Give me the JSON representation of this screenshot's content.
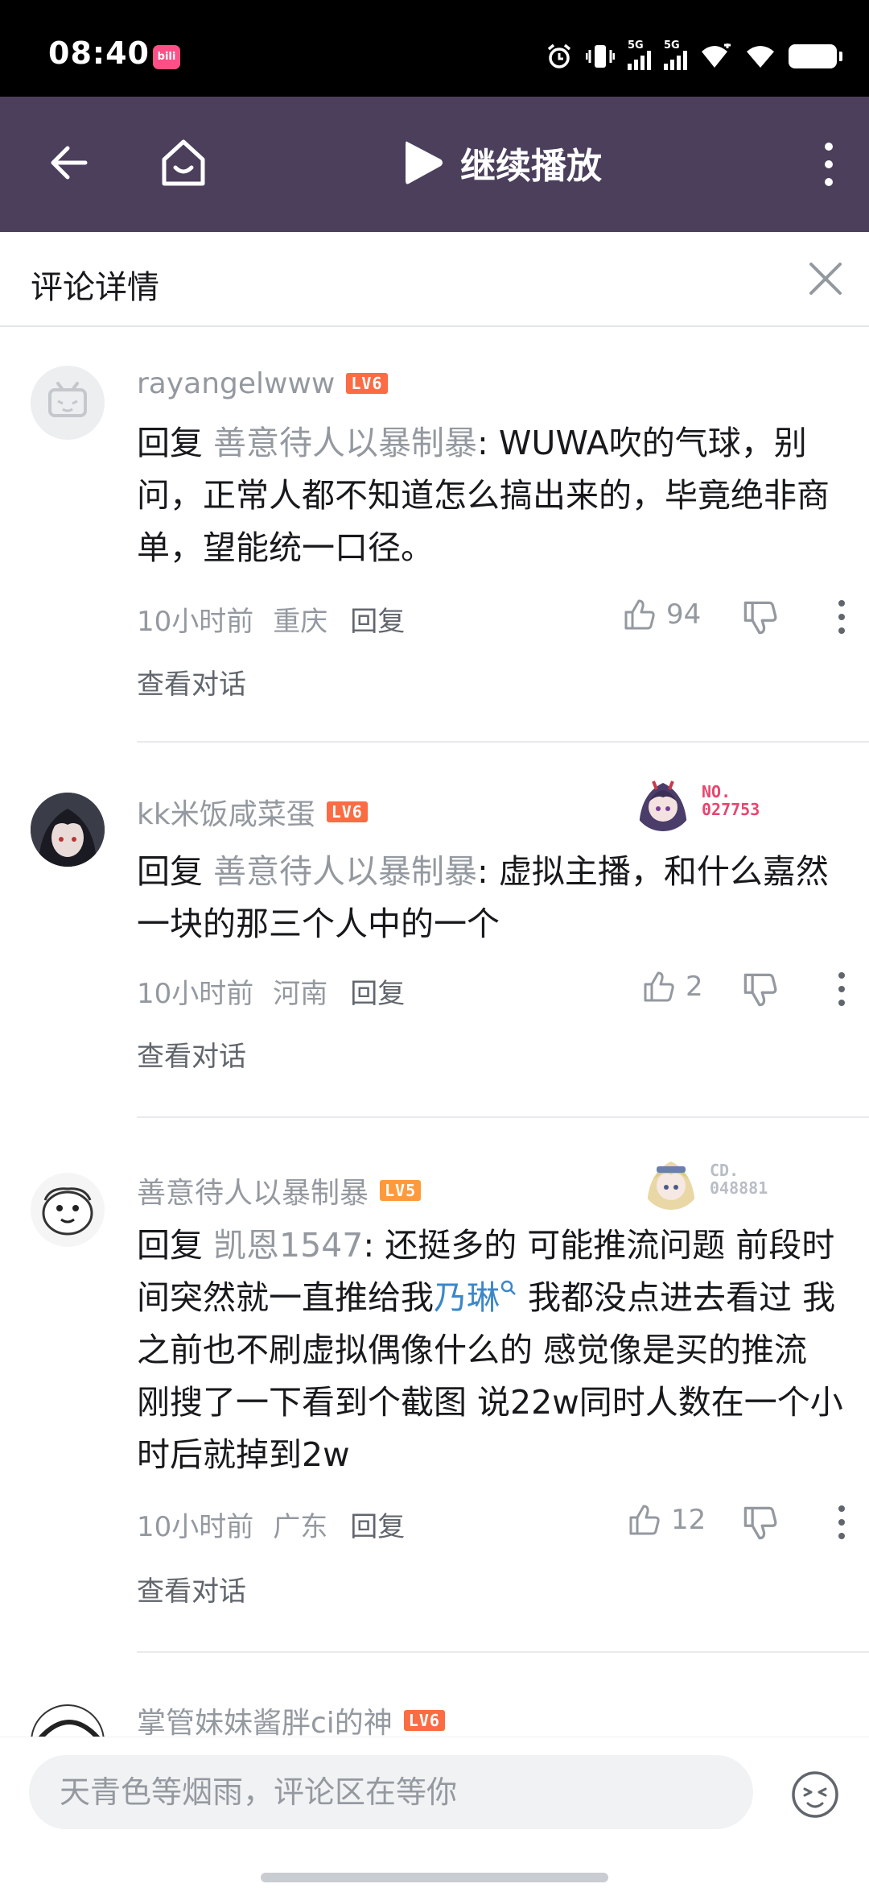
{
  "status_bar": {
    "time": "08:40",
    "app_badge": "bili",
    "network": [
      "5G",
      "5G"
    ],
    "icons": [
      "alarm-icon",
      "vibrate-icon",
      "signal-icon",
      "signal-icon",
      "wifi-plus-icon",
      "wifi-icon",
      "battery-icon"
    ]
  },
  "toolbar": {
    "continue_label": "继续播放",
    "icons": [
      "back-arrow-icon",
      "home-icon",
      "play-icon",
      "more-vertical-icon"
    ]
  },
  "panel": {
    "title": "评论详情",
    "close_icon": "close-icon"
  },
  "comments": [
    {
      "username": "rayangelwww",
      "level": "LV6",
      "reply_prefix": "回复 ",
      "reply_to": "善意待人以暴制暴",
      "text": ": WUWA吹的气球，别问，正常人都不知道怎么搞出来的，毕竟绝非商单，望能统一口径。",
      "time": "10小时前",
      "location": "重庆",
      "reply_label": "回复",
      "likes": "94",
      "view_thread": "查看对话"
    },
    {
      "username": "kk米饭咸菜蛋",
      "level": "LV6",
      "badge_no_label": "NO.",
      "badge_no": "027753",
      "reply_prefix": "回复 ",
      "reply_to": "善意待人以暴制暴",
      "text": ": 虚拟主播，和什么嘉然一块的那三个人中的一个",
      "time": "10小时前",
      "location": "河南",
      "reply_label": "回复",
      "likes": "2",
      "view_thread": "查看对话"
    },
    {
      "username": "善意待人以暴制暴",
      "level": "LV5",
      "badge_no_label": "CD.",
      "badge_no": "048881",
      "reply_prefix": "回复 ",
      "reply_to": "凯恩1547",
      "text_before": ": 还挺多的 可能推流问题 前段时间突然就一直推给我",
      "keyword": "乃琳",
      "text_after": " 我都没点进去看过 我之前也不刷虚拟偶像什么的 感觉像是买的推流 刚搜了一下看到个截图 说22w同时人数在一个小时后就掉到2w",
      "time": "10小时前",
      "location": "广东",
      "reply_label": "回复",
      "likes": "12",
      "view_thread": "查看对话"
    },
    {
      "username": "掌管妹妹酱胖ci的神",
      "level": "LV6"
    }
  ],
  "input": {
    "placeholder": "天青色等烟雨，评论区在等你",
    "emoji_icon": "emoji-icon"
  },
  "colors": {
    "toolbar_bg": "#4b3f5c",
    "level6": "#fb6c44",
    "level5": "#ff9a3c",
    "keyword": "#3c87c8",
    "muted": "#9499a0"
  }
}
